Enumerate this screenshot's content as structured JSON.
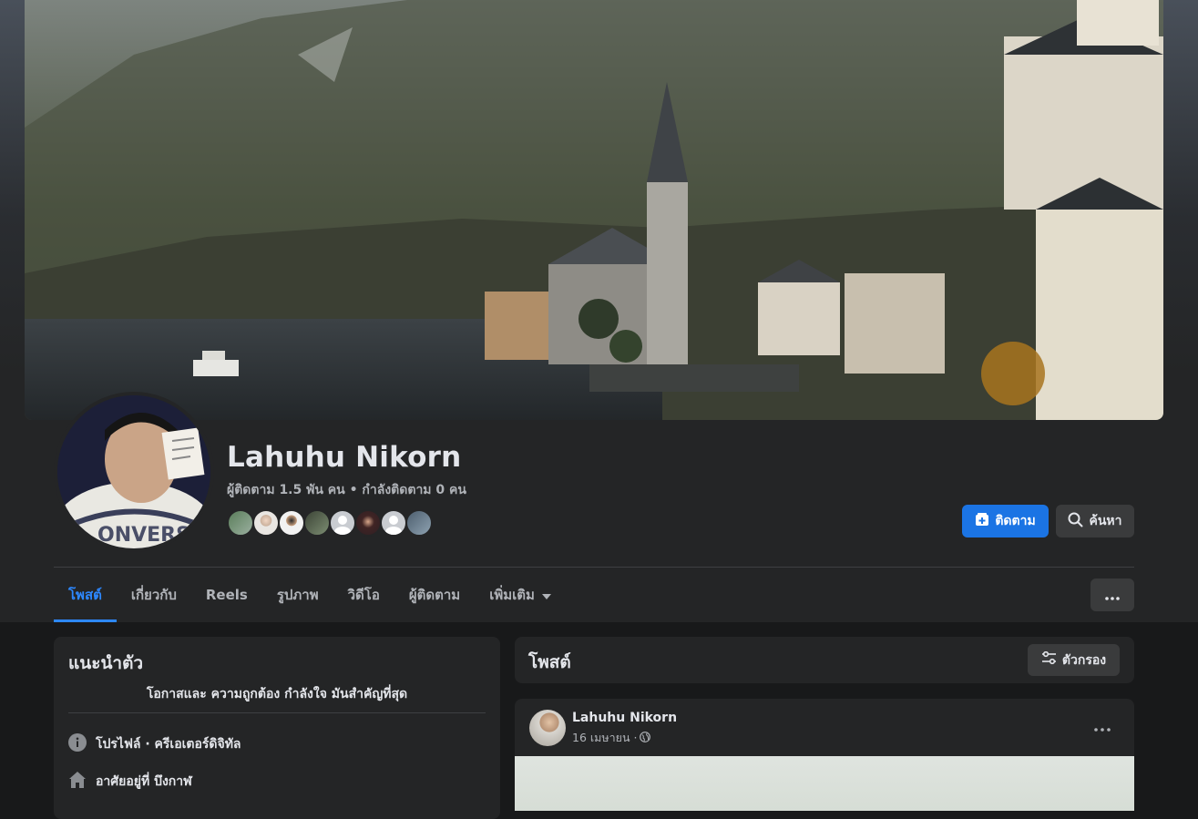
{
  "profile": {
    "name": "Lahuhu Nikorn",
    "follow_info": "ผู้ติดตาม 1.5 พัน คน • กำลังติดตาม 0 คน",
    "friend_avatar_count": 8
  },
  "actions": {
    "follow_label": "ติดตาม",
    "search_label": "ค้นหา"
  },
  "tabs": [
    {
      "label": "โพสต์"
    },
    {
      "label": "เกี่ยวกับ"
    },
    {
      "label": "Reels"
    },
    {
      "label": "รูปภาพ"
    },
    {
      "label": "วิดีโอ"
    },
    {
      "label": "ผู้ติดตาม"
    },
    {
      "label": "เพิ่มเติม"
    }
  ],
  "intro": {
    "title": "แนะนำตัว",
    "bio": "โอกาสและ ความถูกต้อง กำลังใจ มันสำคัญที่สุด",
    "rows": [
      {
        "icon": "info-icon",
        "text": "โปรไฟล์ · ครีเอเตอร์ดิจิทัล"
      },
      {
        "icon": "home-icon",
        "text": "อาศัยอยู่ที่ บึงกาฬ"
      }
    ]
  },
  "posts": {
    "title": "โพสต์",
    "filter_label": "ตัวกรอง"
  },
  "post": {
    "author": "Lahuhu Nikorn",
    "date": "16 เมษายน ·"
  },
  "colors": {
    "accent": "#2d88ff",
    "primary_button": "#1b74e4",
    "card": "#242526",
    "background": "#18191a"
  }
}
